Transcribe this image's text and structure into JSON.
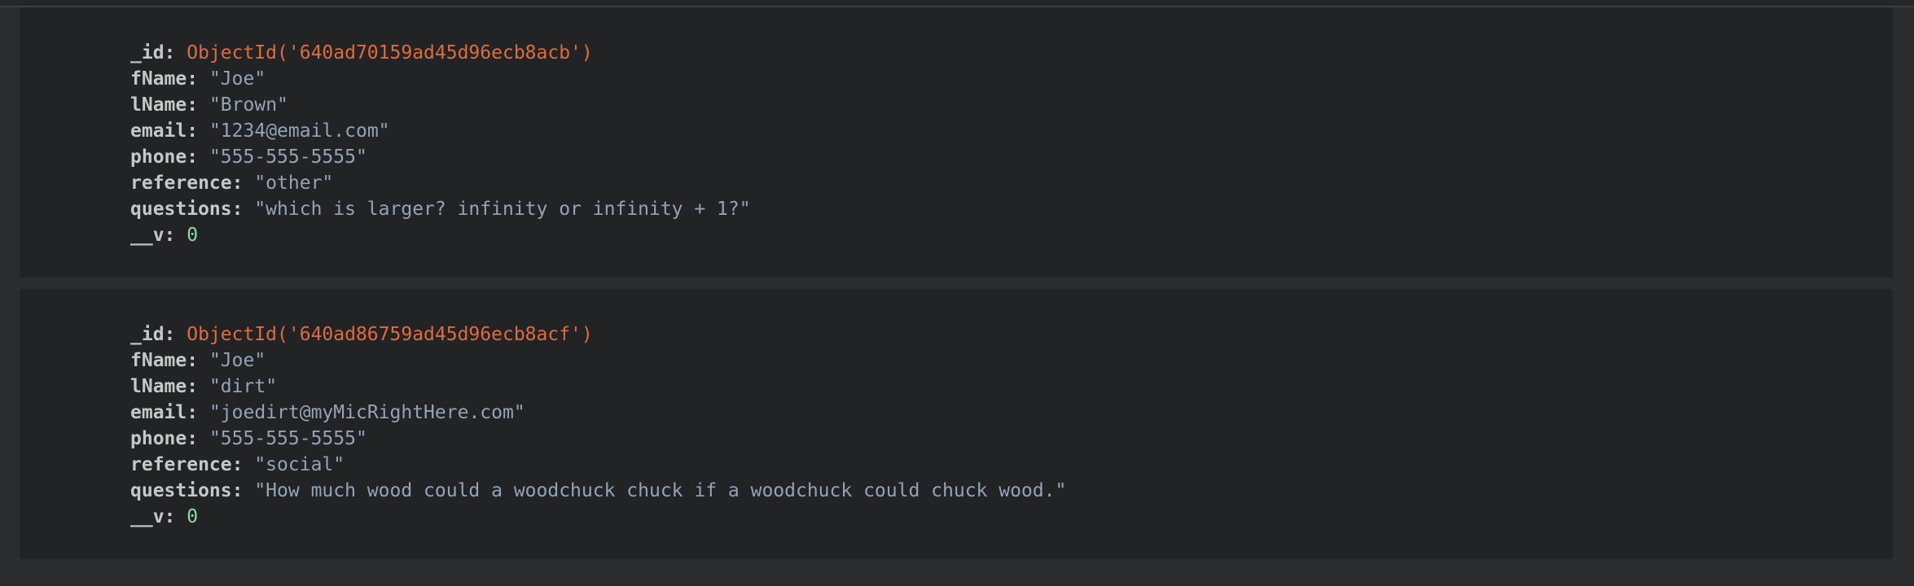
{
  "documents": [
    {
      "fields": [
        {
          "key": "_id",
          "value": "ObjectId('640ad70159ad45d96ecb8acb')",
          "type": "objectid"
        },
        {
          "key": "fName",
          "value": "\"Joe\"",
          "type": "string"
        },
        {
          "key": "lName",
          "value": "\"Brown\"",
          "type": "string"
        },
        {
          "key": "email",
          "value": "\"1234@email.com\"",
          "type": "string"
        },
        {
          "key": "phone",
          "value": "\"555-555-5555\"",
          "type": "string"
        },
        {
          "key": "reference",
          "value": "\"other\"",
          "type": "string"
        },
        {
          "key": "questions",
          "value": "\"which is larger? infinity or infinity + 1?\"",
          "type": "string"
        },
        {
          "key": "__v",
          "value": "0",
          "type": "number"
        }
      ]
    },
    {
      "fields": [
        {
          "key": "_id",
          "value": "ObjectId('640ad86759ad45d96ecb8acf')",
          "type": "objectid"
        },
        {
          "key": "fName",
          "value": "\"Joe\"",
          "type": "string"
        },
        {
          "key": "lName",
          "value": "\"dirt\"",
          "type": "string"
        },
        {
          "key": "email",
          "value": "\"joedirt@myMicRightHere.com\"",
          "type": "string"
        },
        {
          "key": "phone",
          "value": "\"555-555-5555\"",
          "type": "string"
        },
        {
          "key": "reference",
          "value": "\"social\"",
          "type": "string"
        },
        {
          "key": "questions",
          "value": "\"How much wood could a woodchuck chuck if a woodchuck could chuck wood.\"",
          "type": "string"
        },
        {
          "key": "__v",
          "value": "0",
          "type": "number"
        }
      ]
    }
  ],
  "colors": {
    "background": "#2a2c2d",
    "card": "#212325",
    "key": "#c5c8c6",
    "string": "#93a4b6",
    "objectid": "#e06c3c",
    "number": "#8bdc9f"
  }
}
